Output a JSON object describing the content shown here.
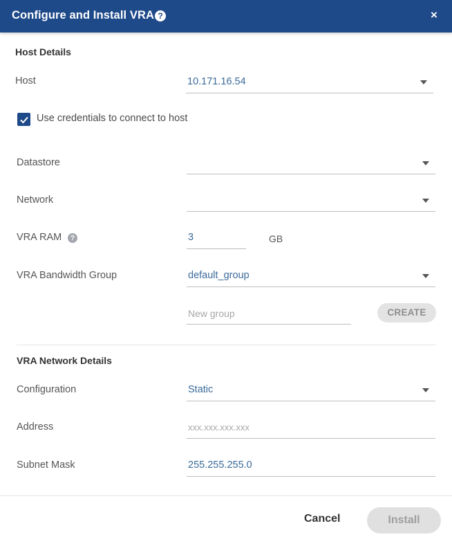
{
  "dialog": {
    "title": "Configure and Install VRA",
    "help_icon": "question-circle-icon",
    "close_icon": "close-icon",
    "close_glyph": "×",
    "help_glyph": "?"
  },
  "host_details": {
    "section_title": "Host Details",
    "host_label": "Host",
    "host_value": "10.171.16.54",
    "use_credentials_label": "Use credentials to connect to host",
    "use_credentials_checked": true,
    "datastore_label": "Datastore",
    "datastore_value": "",
    "network_label": "Network",
    "network_value": "",
    "vra_ram_label": "VRA RAM",
    "vra_ram_value": "3",
    "vra_ram_unit": "GB",
    "bandwidth_group_label": "VRA Bandwidth Group",
    "bandwidth_group_value": "default_group",
    "new_group_placeholder": "New group",
    "create_button_label": "CREATE"
  },
  "network_details": {
    "section_title": "VRA Network Details",
    "configuration_label": "Configuration",
    "configuration_value": "Static",
    "address_label": "Address",
    "address_placeholder": "xxx.xxx.xxx.xxx",
    "subnet_mask_label": "Subnet Mask",
    "subnet_mask_value": "255.255.255.0"
  },
  "footer": {
    "cancel_label": "Cancel",
    "install_label": "Install"
  },
  "colors": {
    "header_bg": "#1f4a8a",
    "value_text": "#3b6a9a",
    "disabled_button_bg": "#e0e0e0"
  }
}
